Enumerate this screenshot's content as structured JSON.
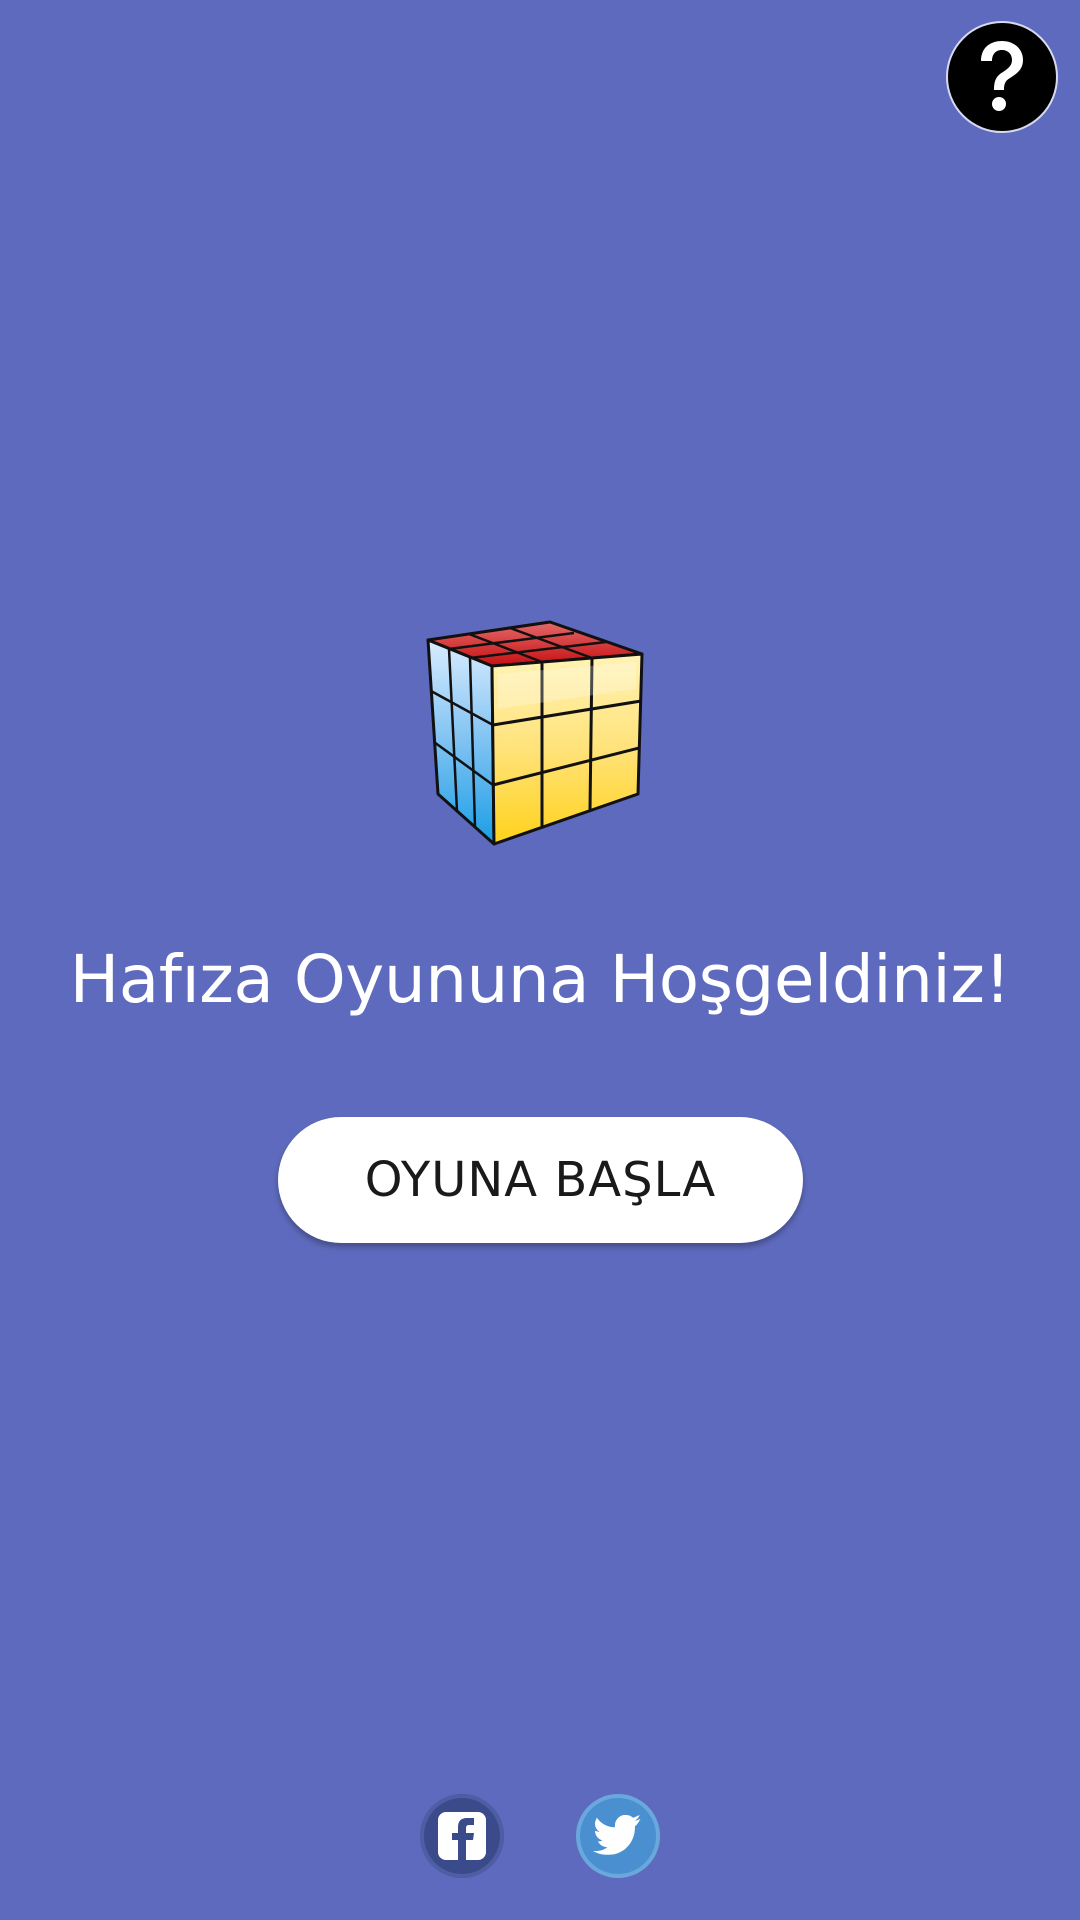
{
  "colors": {
    "background": "#5e6abd",
    "help_button": "#000000",
    "start_button": "#ffffff",
    "facebook": "#3b4a8a",
    "twitter": "#4a8fcf"
  },
  "help": {
    "icon": "question-mark-icon"
  },
  "logo": {
    "icon": "rubiks-cube-icon"
  },
  "welcome_text": "Hafıza Oyununa Hoşgeldiniz!",
  "start_button_label": "OYUNA BAŞLA",
  "social": {
    "facebook_icon": "facebook-icon",
    "twitter_icon": "twitter-icon"
  }
}
